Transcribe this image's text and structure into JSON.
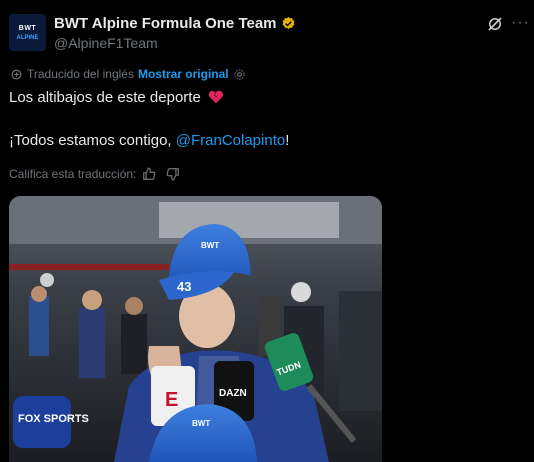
{
  "header": {
    "account_name": "BWT Alpine Formula One Team",
    "handle": "@AlpineF1Team",
    "avatar_text": "BWT",
    "avatar_subtext": "ALPINE"
  },
  "translation": {
    "status": "Traducido del inglés",
    "show_original": "Mostrar original"
  },
  "tweet": {
    "line1": "Los altibajos de este deporte",
    "line2_prefix": "¡Todos estamos contigo, ",
    "mention": "@FranColapinto",
    "line2_suffix": "!"
  },
  "rating": {
    "label": "Califica esta traducción:"
  },
  "media": {
    "cap_text": "BWT",
    "cap_number": "43",
    "mic_labels": [
      "E",
      "DAZN",
      "TUDN",
      "FOX SPORTS"
    ]
  },
  "colors": {
    "accent": "#1d9bf0",
    "verified": "#e8b100",
    "heart": "#e0245e"
  }
}
